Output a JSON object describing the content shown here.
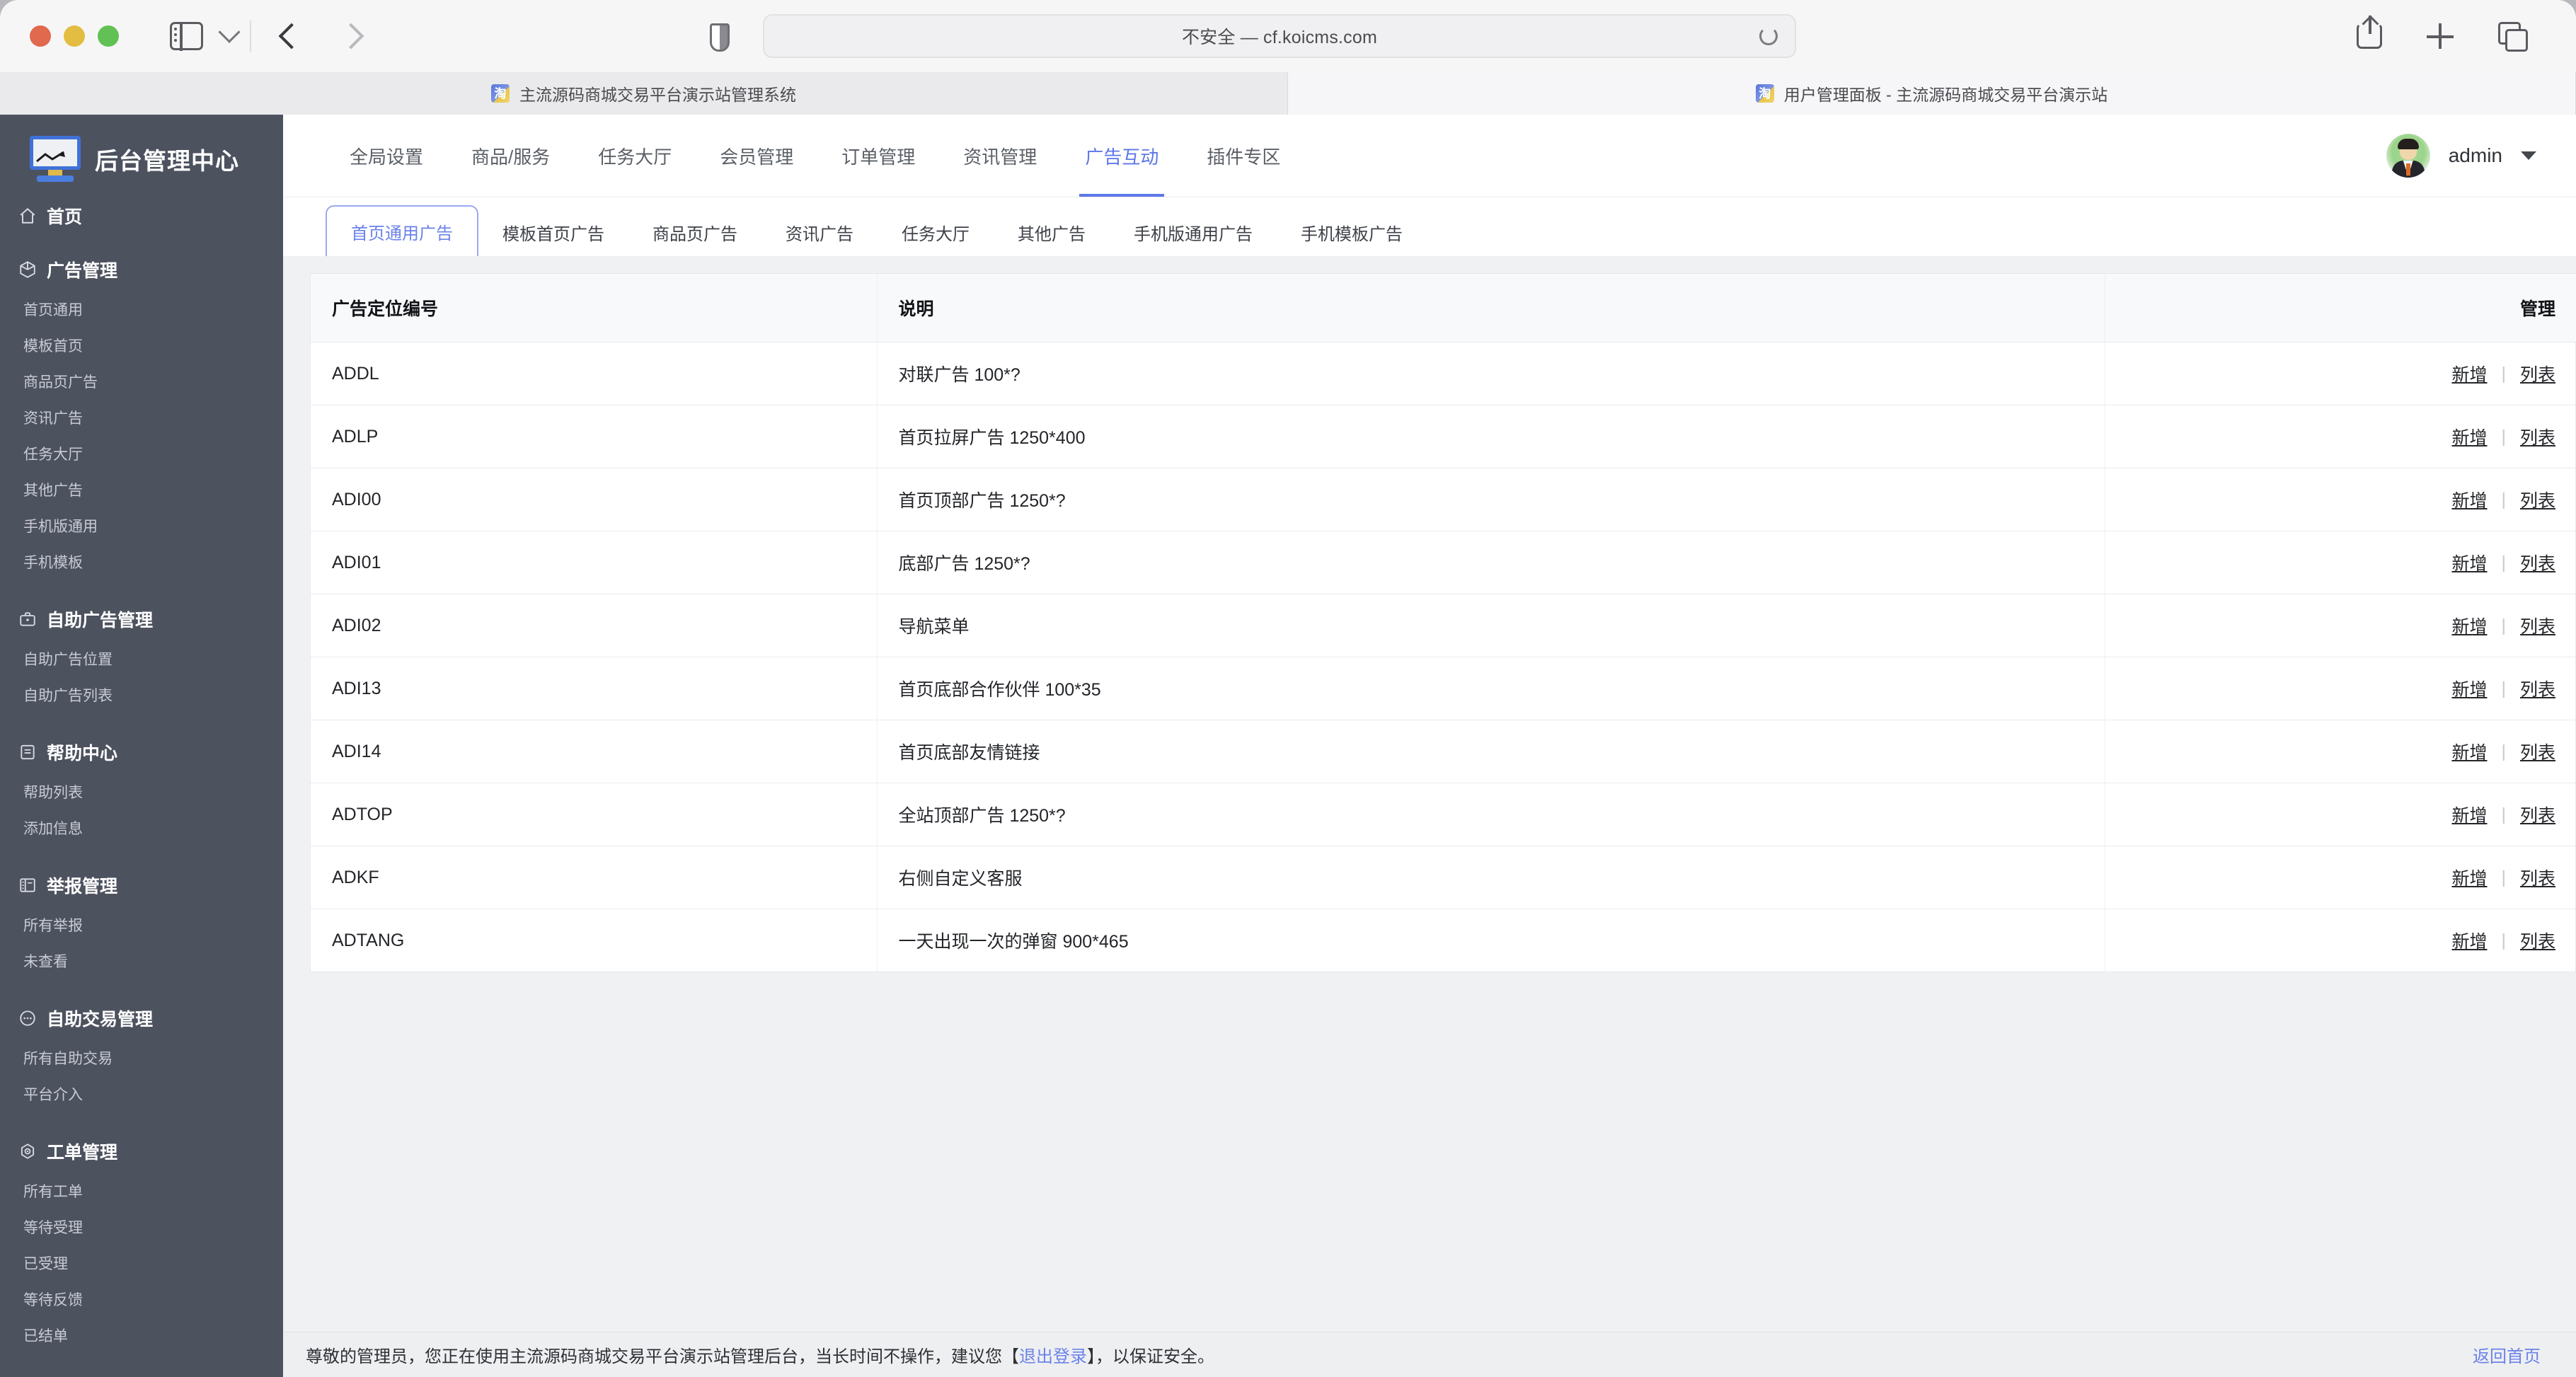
{
  "browser": {
    "window_controls": [
      "close",
      "minimize",
      "maximize"
    ],
    "url": "不安全 — cf.koicms.com",
    "tabs": [
      {
        "title": "主流源码商城交易平台演示站管理系统",
        "favicon": "淘",
        "active": false
      },
      {
        "title": "用户管理面板 - 主流源码商城交易平台演示站",
        "favicon": "淘",
        "active": true
      }
    ],
    "toolbar_icons": [
      "sidebar-toggle-icon",
      "chevron-down-icon",
      "back-arrow-icon",
      "forward-arrow-icon",
      "shield-icon",
      "reload-icon",
      "share-icon",
      "new-tab-icon",
      "tab-overview-icon"
    ]
  },
  "sidebar": {
    "brand": "后台管理中心",
    "home": {
      "label": "首页",
      "icon": "home-icon"
    },
    "sections": [
      {
        "title": "广告管理",
        "icon": "cube-icon",
        "items": [
          "首页通用",
          "模板首页",
          "商品页广告",
          "资讯广告",
          "任务大厅",
          "其他广告",
          "手机版通用",
          "手机模板"
        ]
      },
      {
        "title": "自助广告管理",
        "icon": "briefcase-icon",
        "items": [
          "自助广告位置",
          "自助广告列表"
        ]
      },
      {
        "title": "帮助中心",
        "icon": "document-icon",
        "items": [
          "帮助列表",
          "添加信息"
        ]
      },
      {
        "title": "举报管理",
        "icon": "report-icon",
        "items": [
          "所有举报",
          "未查看"
        ]
      },
      {
        "title": "自助交易管理",
        "icon": "chat-icon",
        "items": [
          "所有自助交易",
          "平台介入"
        ]
      },
      {
        "title": "工单管理",
        "icon": "gear-icon",
        "items": [
          "所有工单",
          "等待受理",
          "已受理",
          "等待反馈",
          "已结单"
        ]
      }
    ]
  },
  "topnav": {
    "items": [
      "全局设置",
      "商品/服务",
      "任务大厅",
      "会员管理",
      "订单管理",
      "资讯管理",
      "广告互动",
      "插件专区"
    ],
    "active": "广告互动",
    "user": {
      "name": "admin",
      "avatar": "user-avatar",
      "caret": "chevron-down-icon"
    }
  },
  "tabs": {
    "items": [
      "首页通用广告",
      "模板首页广告",
      "商品页广告",
      "资讯广告",
      "任务大厅",
      "其他广告",
      "手机版通用广告",
      "手机模板广告"
    ],
    "active": "首页通用广告"
  },
  "table": {
    "columns": [
      "广告定位编号",
      "说明",
      "管理"
    ],
    "action_add": "新增",
    "action_list": "列表",
    "separator": "|",
    "rows": [
      {
        "code": "ADDL",
        "desc": "对联广告 100*?"
      },
      {
        "code": "ADLP",
        "desc": "首页拉屏广告 1250*400"
      },
      {
        "code": "ADI00",
        "desc": "首页顶部广告 1250*?"
      },
      {
        "code": "ADI01",
        "desc": "底部广告 1250*?"
      },
      {
        "code": "ADI02",
        "desc": "导航菜单"
      },
      {
        "code": "ADI13",
        "desc": "首页底部合作伙伴 100*35"
      },
      {
        "code": "ADI14",
        "desc": "首页底部友情链接"
      },
      {
        "code": "ADTOP",
        "desc": "全站顶部广告 1250*?"
      },
      {
        "code": "ADKF",
        "desc": "右侧自定义客服"
      },
      {
        "code": "ADTANG",
        "desc": "一天出现一次的弹窗 900*465"
      }
    ]
  },
  "footer": {
    "text_before": "尊敬的管理员，您正在使用主流源码商城交易平台演示站管理后台，当长时间不操作，建议您【",
    "logout_link": "退出登录",
    "text_after": "】，以保证安全。",
    "home_link": "返回首页"
  },
  "colors": {
    "accent": "#5b77e8",
    "tab_accent": "#6b82ea",
    "sidebar_bg": "#4d525f",
    "page_bg": "#f0f1f3"
  }
}
